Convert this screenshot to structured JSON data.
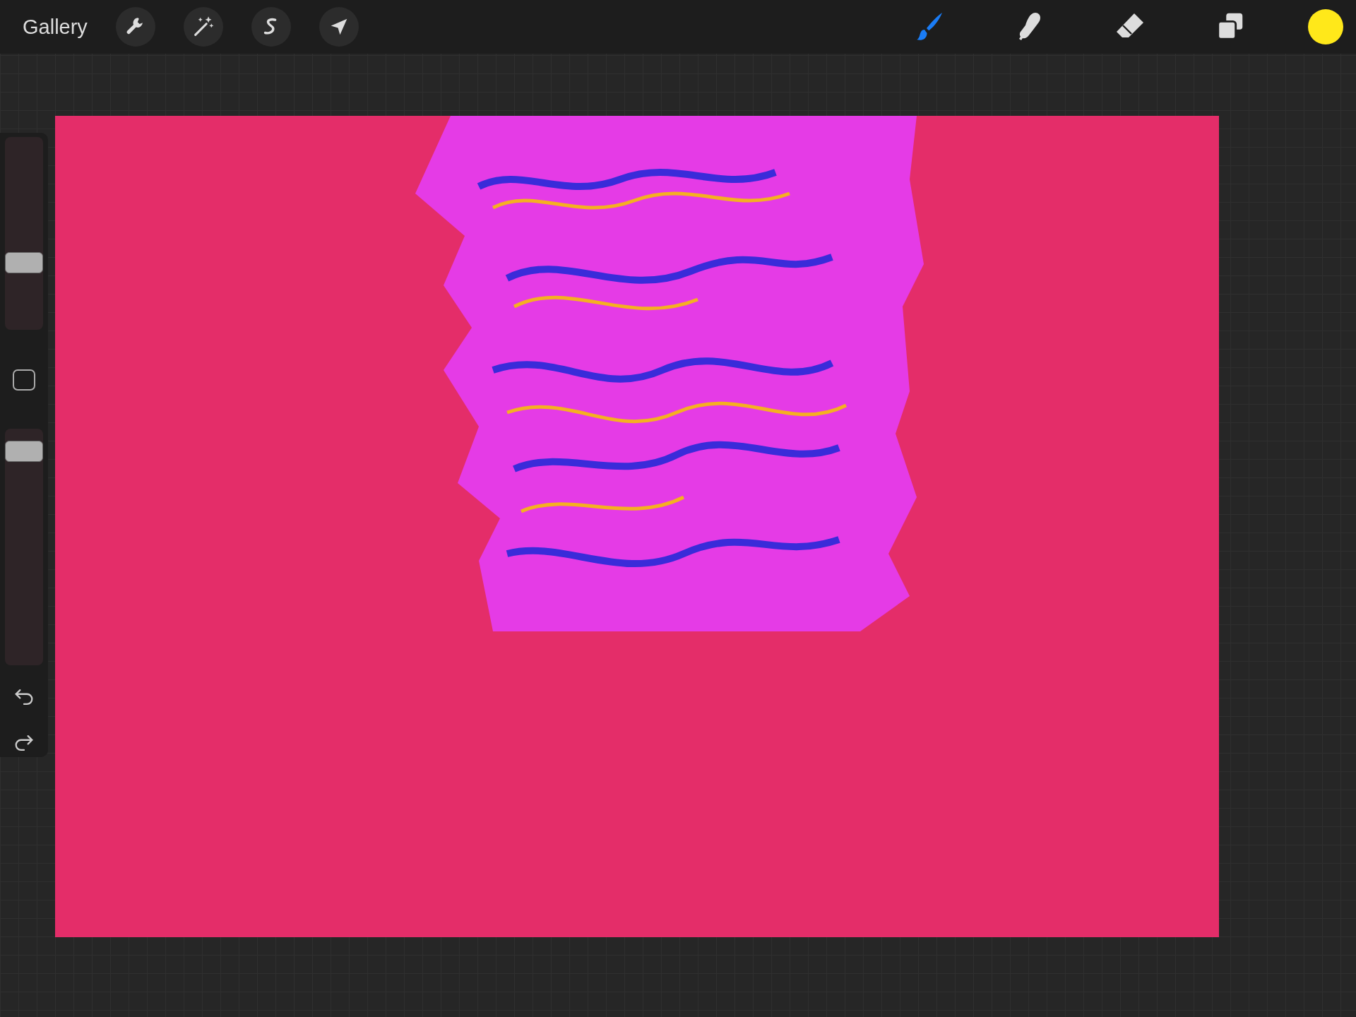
{
  "toolbar": {
    "gallery_label": "Gallery",
    "actions": [
      {
        "kind": "wrench"
      },
      {
        "kind": "wand"
      },
      {
        "kind": "selection"
      },
      {
        "kind": "transform"
      }
    ],
    "tools": [
      {
        "kind": "brush",
        "selected": true
      },
      {
        "kind": "smudge",
        "selected": false
      },
      {
        "kind": "eraser",
        "selected": false
      }
    ]
  },
  "sidebar": {
    "sliders": [
      {
        "level": 0.31
      },
      {
        "level": 0.95
      }
    ]
  }
}
